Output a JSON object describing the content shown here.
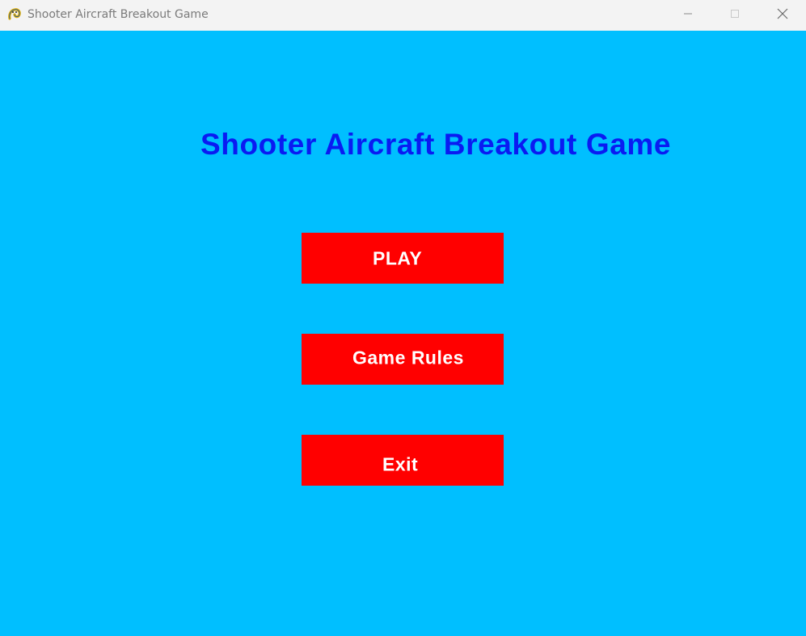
{
  "window": {
    "title": "Shooter Aircraft Breakout Game",
    "app_icon": "pygame-snake-icon",
    "controls": [
      "minimize-icon",
      "maximize-icon",
      "close-icon"
    ]
  },
  "game": {
    "background_color": "#00bfff",
    "title": "Shooter Aircraft Breakout Game",
    "title_color": "#0a1bf2",
    "button_color": "#ff0000",
    "button_text_color": "#ffffff",
    "menu": {
      "play_label": "PLAY",
      "rules_label": "Game Rules",
      "exit_label": "Exit"
    }
  }
}
